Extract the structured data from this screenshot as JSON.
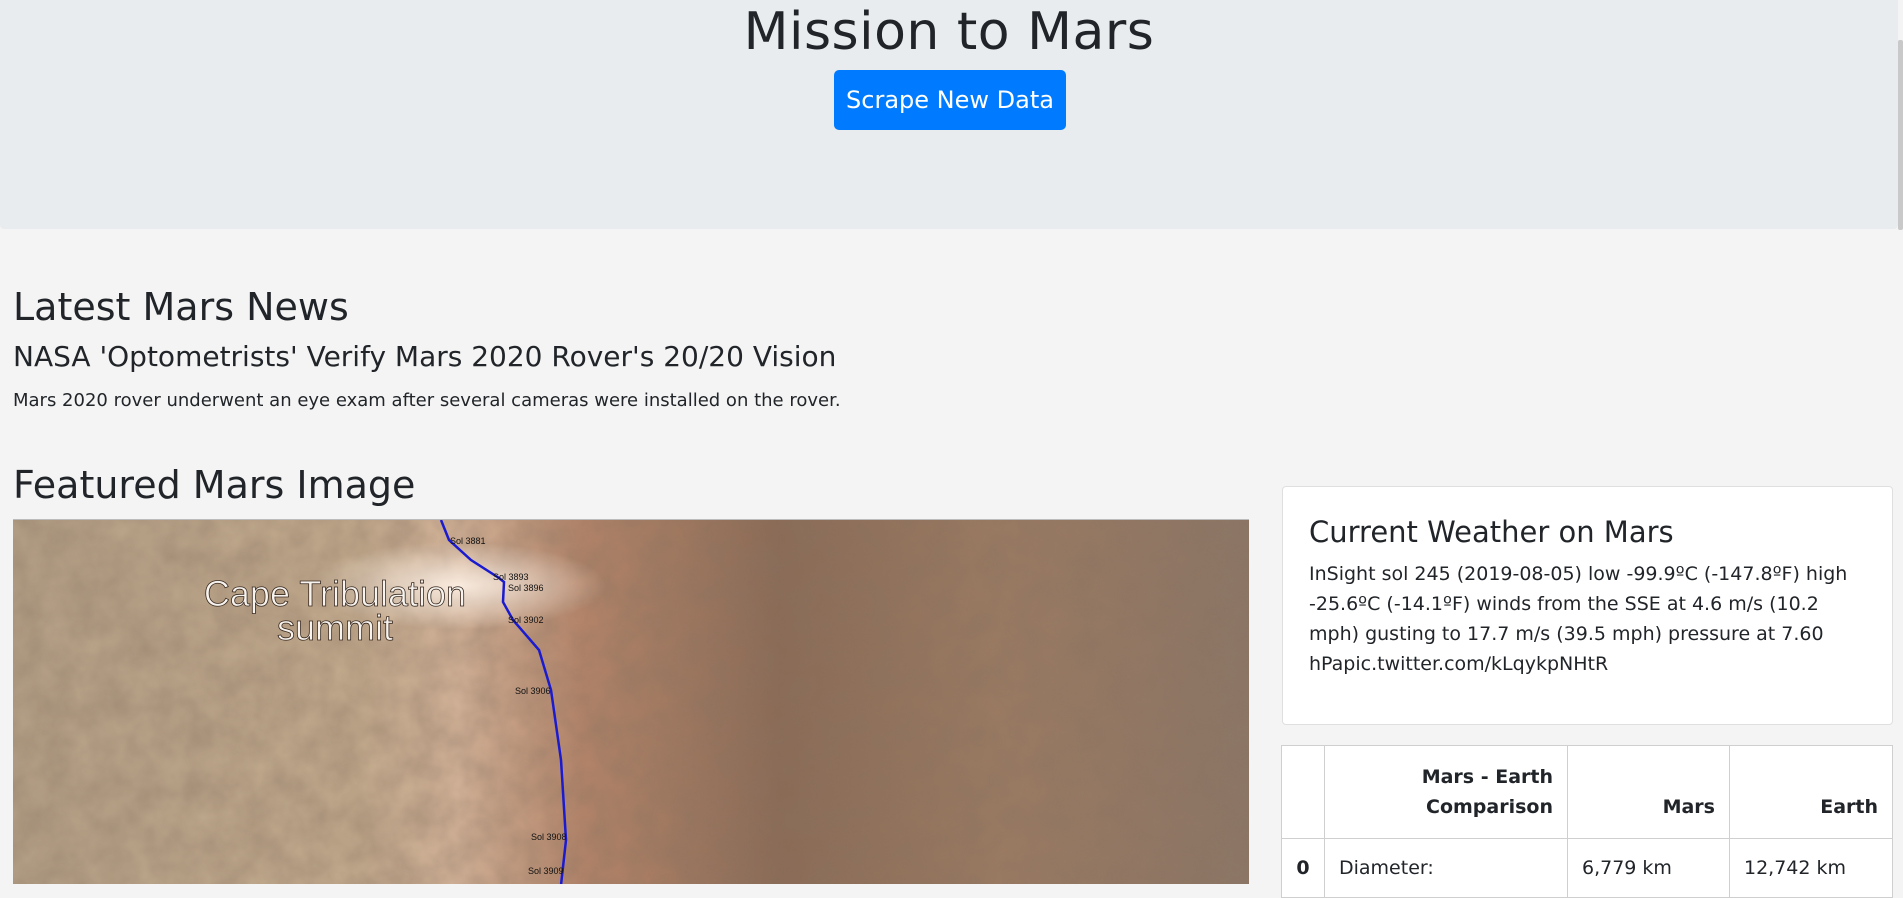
{
  "header": {
    "title": "Mission to Mars",
    "scrape_button": "Scrape New Data"
  },
  "news": {
    "section_title": "Latest Mars News",
    "headline": "NASA 'Optometrists' Verify Mars 2020 Rover's 20/20 Vision",
    "teaser": "Mars 2020 rover underwent an eye exam after several cameras were installed on the rover."
  },
  "featured": {
    "section_title": "Featured Mars Image",
    "image_label_line1": "Cape Tribulation",
    "image_label_line2": "summit",
    "sol_labels": [
      "Sol 3881",
      "Sol 3893",
      "Sol 3896",
      "Sol 3902",
      "Sol 3906",
      "Sol 3908",
      "Sol 3909"
    ]
  },
  "weather": {
    "title": "Current Weather on Mars",
    "text": "InSight sol 245 (2019-08-05) low -99.9ºC (-147.8ºF) high -25.6ºC (-14.1ºF) winds from the SSE at 4.6 m/s (10.2 mph) gusting to 17.7 m/s (39.5 mph) pressure at 7.60 hPapic.twitter.com/kLqykpNHtR"
  },
  "facts_table": {
    "headers": [
      "",
      "Mars - Earth Comparison",
      "Mars",
      "Earth"
    ],
    "rows": [
      [
        "0",
        "Diameter:",
        "6,779 km",
        "12,742 km"
      ]
    ]
  },
  "colors": {
    "accent": "#007bff",
    "jumbotron_bg": "#e9ecef",
    "page_bg": "#f4f4f4"
  }
}
